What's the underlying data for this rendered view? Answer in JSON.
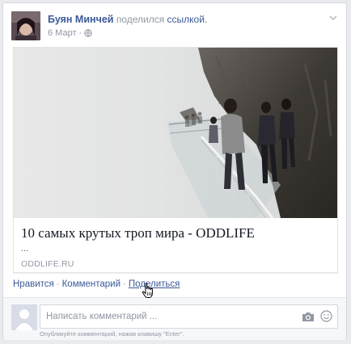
{
  "post": {
    "author": "Буян Минчей",
    "shared_text": "поделился",
    "link_word": "ссылкой.",
    "date": "6 Март",
    "dot": "·"
  },
  "link": {
    "title": "10 самых крутых троп мира - ODDLIFE",
    "description": "...",
    "domain": "ODDLIFE.RU"
  },
  "actions": {
    "like": "Нравится",
    "comment": "Комментарий",
    "share": "Поделиться",
    "sep": "·"
  },
  "comment": {
    "placeholder": "Написать комментарий ...",
    "hint": "Опубликуйте комментарий, нажав клавишу \"Enter\"."
  },
  "icons": {
    "menu": "chevron-down-icon",
    "privacy": "globe-icon",
    "camera": "camera-icon",
    "emoji": "smile-icon",
    "cursor": "hand-cursor-icon"
  },
  "colors": {
    "link_blue": "#3b5998",
    "muted": "#9197a3",
    "background": "#e9ebee"
  }
}
